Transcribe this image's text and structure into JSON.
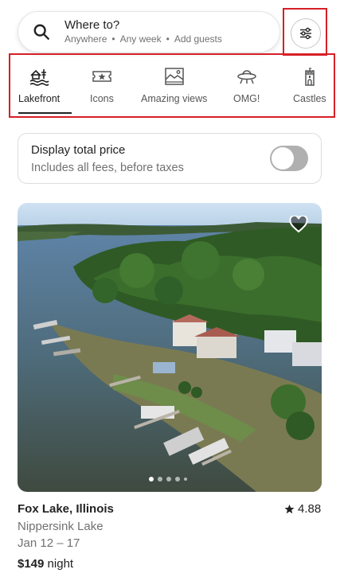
{
  "search": {
    "title": "Where to?",
    "location": "Anywhere",
    "dates": "Any week",
    "guests": "Add guests",
    "separator": "•"
  },
  "categories": [
    {
      "label": "Lakefront",
      "icon": "lakefront-icon",
      "active": true
    },
    {
      "label": "Icons",
      "icon": "icons-ticket-icon",
      "active": false
    },
    {
      "label": "Amazing views",
      "icon": "amazing-views-icon",
      "active": false
    },
    {
      "label": "OMG!",
      "icon": "ufo-icon",
      "active": false
    },
    {
      "label": "Castles",
      "icon": "castle-icon",
      "active": false
    }
  ],
  "total_price": {
    "title": "Display total price",
    "subtitle": "Includes all fees, before taxes",
    "enabled": false
  },
  "listing": {
    "location": "Fox Lake, Illinois",
    "rating": "4.88",
    "place": "Nippersink Lake",
    "dates": "Jan 12 – 17",
    "price": "$149",
    "price_unit": "night",
    "photo_count": 5,
    "current_photo": 1
  },
  "colors": {
    "highlight_border": "#d61f26",
    "text_primary": "#222222",
    "text_secondary": "#717171",
    "toggle_off": "#b0b0b0"
  }
}
